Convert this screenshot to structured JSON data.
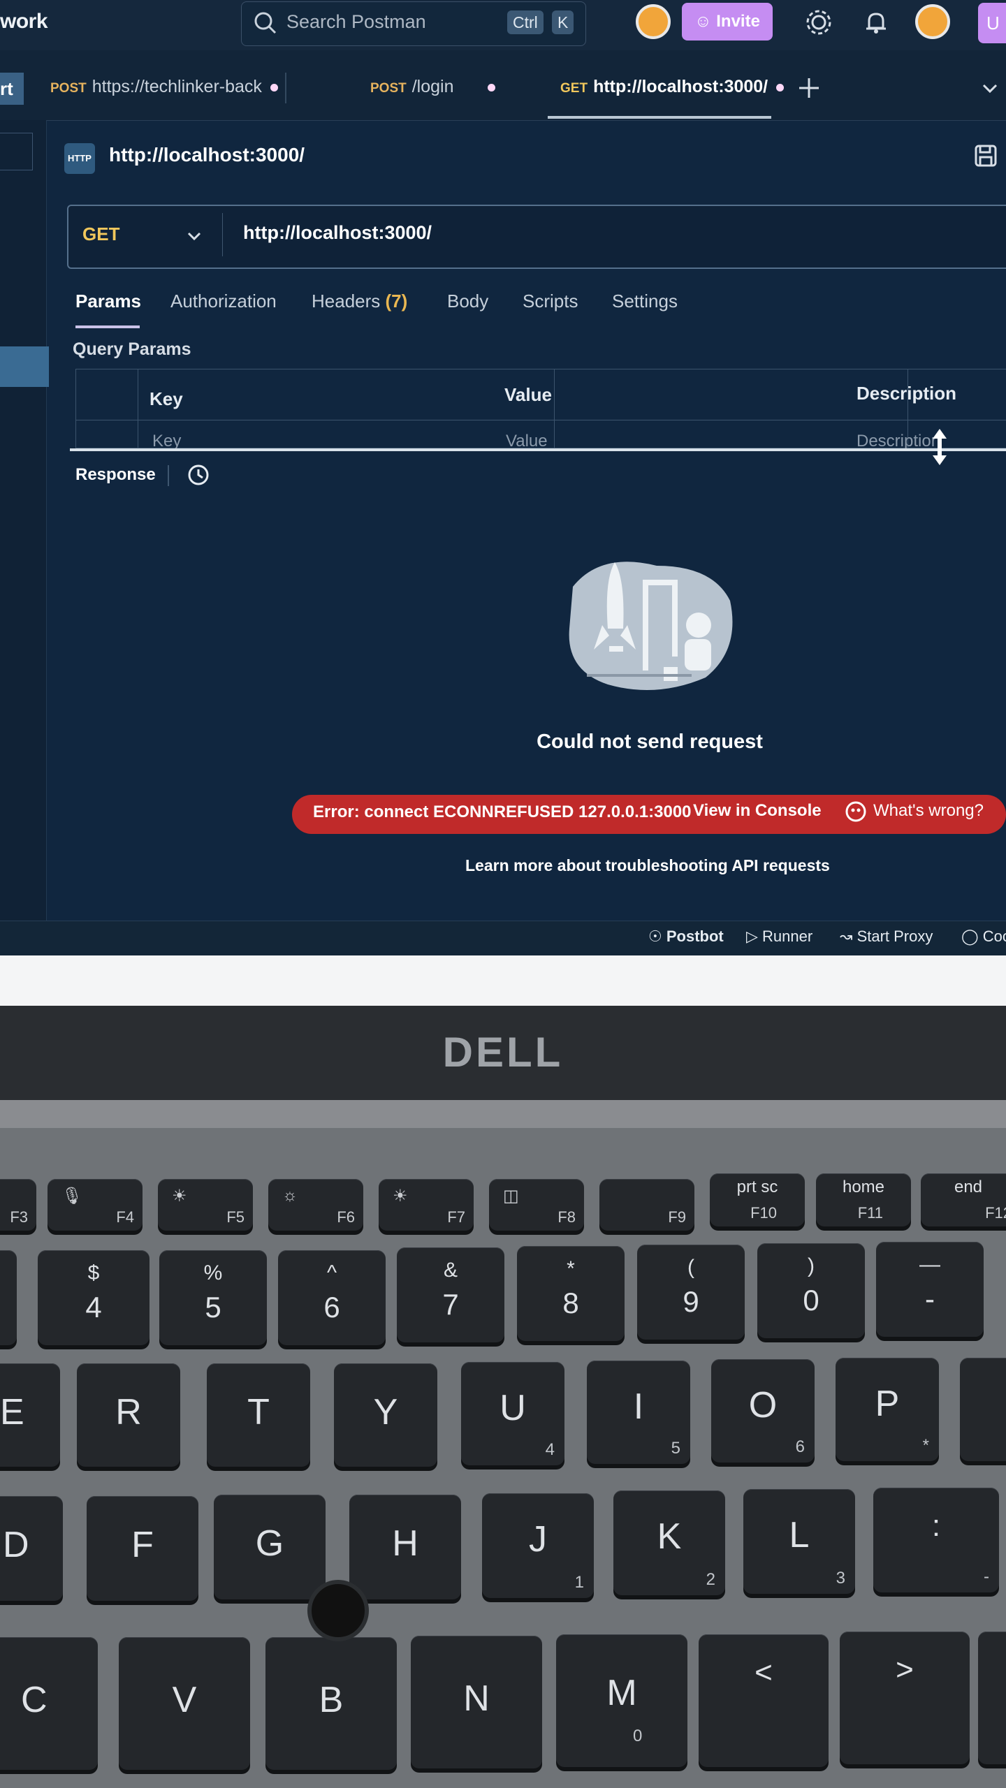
{
  "topbar": {
    "brand": "work",
    "search_placeholder": "Search Postman",
    "shortcut_1": "Ctrl",
    "shortcut_2": "K",
    "invite_label": "Invite",
    "upgrade_label": "U"
  },
  "sidebar": {
    "button_label": "rt"
  },
  "tabs": [
    {
      "method": "POST",
      "label": "https://techlinker-back",
      "unsaved": true
    },
    {
      "method": "POST",
      "label": "/login",
      "unsaved": true
    },
    {
      "method": "GET",
      "label": "http://localhost:3000/",
      "unsaved": true,
      "active": true
    }
  ],
  "request": {
    "icon_label": "HTTP",
    "title": "http://localhost:3000/",
    "method": "GET",
    "url": "http://localhost:3000/"
  },
  "request_tabs": {
    "params": "Params",
    "authorization": "Authorization",
    "headers": "Headers",
    "headers_count": "(7)",
    "body": "Body",
    "scripts": "Scripts",
    "settings": "Settings"
  },
  "query_params": {
    "label": "Query Params",
    "columns": [
      "Key",
      "Value",
      "Description"
    ],
    "placeholders": [
      "Key",
      "Value",
      "Description"
    ]
  },
  "response": {
    "label": "Response",
    "error_title": "Could not send request",
    "error_message": "Error: connect ECONNREFUSED 127.0.0.1:3000",
    "view_console": "View in Console",
    "whats_wrong": "What's wrong?",
    "learn_more": "Learn more about troubleshooting API requests"
  },
  "statusbar": {
    "postbot": "Postbot",
    "runner": "Runner",
    "start_proxy": "Start Proxy",
    "cookies": "Coo"
  },
  "laptop": {
    "brand": "DELL",
    "fn_keys": [
      {
        "top": "",
        "label": "F3"
      },
      {
        "top": "",
        "label": "F4"
      },
      {
        "top": "",
        "label": "F5"
      },
      {
        "top": "",
        "label": "F6"
      },
      {
        "top": "",
        "label": "F7"
      },
      {
        "top": "",
        "label": "F8"
      },
      {
        "top": "",
        "label": "F9"
      },
      {
        "top": "prt sc",
        "label": "F10"
      },
      {
        "top": "home",
        "label": "F11"
      },
      {
        "top": "end",
        "label": "F12"
      }
    ],
    "number_keys": [
      {
        "top": "$",
        "main": "4"
      },
      {
        "top": "%",
        "main": "5"
      },
      {
        "top": "^",
        "main": "6"
      },
      {
        "top": "&",
        "main": "7"
      },
      {
        "top": "*",
        "main": "8"
      },
      {
        "top": "(",
        "main": "9"
      },
      {
        "top": ")",
        "main": "0"
      },
      {
        "top": "—",
        "main": "-"
      }
    ],
    "row_qwerty": [
      {
        "main": "E",
        "sub": ""
      },
      {
        "main": "R",
        "sub": ""
      },
      {
        "main": "T",
        "sub": ""
      },
      {
        "main": "Y",
        "sub": ""
      },
      {
        "main": "U",
        "sub": "4"
      },
      {
        "main": "I",
        "sub": "5"
      },
      {
        "main": "O",
        "sub": "6"
      },
      {
        "main": "P",
        "sub": "*"
      }
    ],
    "row_home": [
      {
        "main": "D",
        "sub": ""
      },
      {
        "main": "F",
        "sub": ""
      },
      {
        "main": "G",
        "sub": ""
      },
      {
        "main": "H",
        "sub": ""
      },
      {
        "main": "J",
        "sub": "1"
      },
      {
        "main": "K",
        "sub": "2"
      },
      {
        "main": "L",
        "sub": "3"
      },
      {
        "main": ":",
        "sub": "-"
      }
    ],
    "row_bottom": [
      {
        "main": "C",
        "sub": ""
      },
      {
        "main": "V",
        "sub": ""
      },
      {
        "main": "B",
        "sub": ""
      },
      {
        "main": "N",
        "sub": ""
      },
      {
        "main": "M",
        "sub": "0"
      },
      {
        "main": "<",
        "sub": ""
      },
      {
        "main": ">",
        "sub": ""
      }
    ]
  }
}
